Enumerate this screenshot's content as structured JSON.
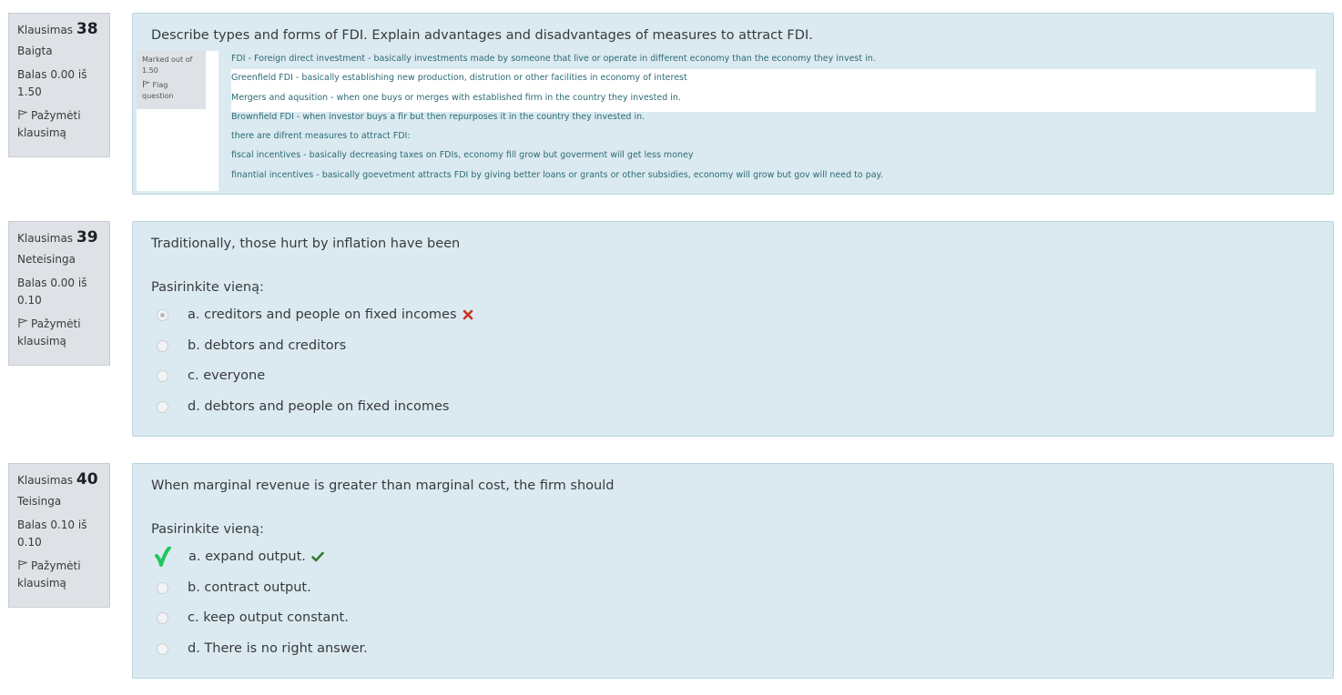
{
  "questions": [
    {
      "label": "Klausimas",
      "number": "38",
      "state": "Baigta",
      "grade_line1": "Balas 0.00 iš",
      "grade_line2": "1.50",
      "flag_line1": "Pažymėti",
      "flag_line2": "klausimą",
      "text": "Describe types and forms of FDI. Explain advantages and disadvantages of measures to attract FDI.",
      "embedded": {
        "side_marked_line1": "Marked out of",
        "side_marked_line2": "1.50",
        "side_flag_line1": "Flag",
        "side_flag_line2": "question",
        "lines": [
          "FDI - Foreign direct investment - basically investments made by someone that live or operate in different economy than the economy they invest in.",
          "Greenfield FDI - basically establishing new production, distrution or other facilities in economy of interest",
          "Mergers and aqusition - when one buys or merges with established firm in the country they invested in.",
          "Brownfield FDI - when investor buys a fir but then repurposes it in the country they invested in.",
          "there are difrent measures to attract FDI:",
          "fiscal incentives - basically decreasing taxes on FDIs, economy fill grow but goverment will get less money",
          "finantial incentives - basically goevetment attracts FDI by giving better loans or grants or other subsidies, economy will grow but gov will need to pay."
        ]
      }
    },
    {
      "label": "Klausimas",
      "number": "39",
      "state": "Neteisinga",
      "grade_line1": "Balas 0.00 iš",
      "grade_line2": "0.10",
      "flag_line1": "Pažymėti",
      "flag_line2": "klausimą",
      "text": "Traditionally, those hurt by inflation have been",
      "prompt": "Pasirinkite vieną:",
      "answers": [
        "a. creditors and people on fixed incomes",
        "b. debtors and creditors",
        "c. everyone",
        "d. debtors and people on fixed incomes"
      ],
      "selected_index": 0,
      "result_icon": "incorrect-cross-icon",
      "result_color": "#ca3120"
    },
    {
      "label": "Klausimas",
      "number": "40",
      "state": "Teisinga",
      "grade_line1": "Balas 0.10 iš",
      "grade_line2": "0.10",
      "flag_line1": "Pažymėti",
      "flag_line2": "klausimą",
      "text": "When marginal revenue is greater than marginal cost, the firm should",
      "prompt": "Pasirinkite vieną:",
      "answers": [
        "a. expand output.",
        "b. contract output.",
        "c. keep output constant.",
        "d. There is no right answer."
      ],
      "selected_index": 0,
      "result_icon": "correct-check-icon",
      "result_color": "#357a32",
      "selection_mark_color": "#22c55e"
    }
  ]
}
